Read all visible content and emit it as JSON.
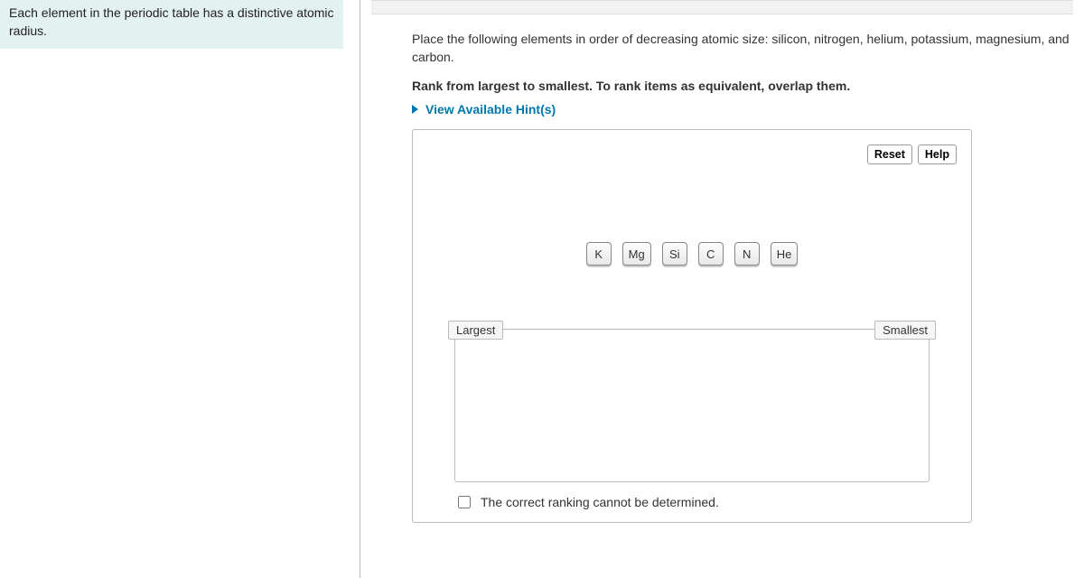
{
  "sidebar": {
    "info_text": "Each element in the periodic table has a distinctive atomic radius."
  },
  "question": {
    "prompt": "Place the following elements in order of decreasing atomic size: silicon, nitrogen, helium, potassium, magnesium, and carbon.",
    "instruction": "Rank from largest to smallest. To rank items as equivalent, overlap them.",
    "hints_label": "View Available Hint(s)"
  },
  "panel": {
    "reset_label": "Reset",
    "help_label": "Help",
    "tiles": [
      "K",
      "Mg",
      "Si",
      "C",
      "N",
      "He"
    ],
    "rank_left": "Largest",
    "rank_right": "Smallest",
    "undetermined_label": "The correct ranking cannot be determined."
  }
}
